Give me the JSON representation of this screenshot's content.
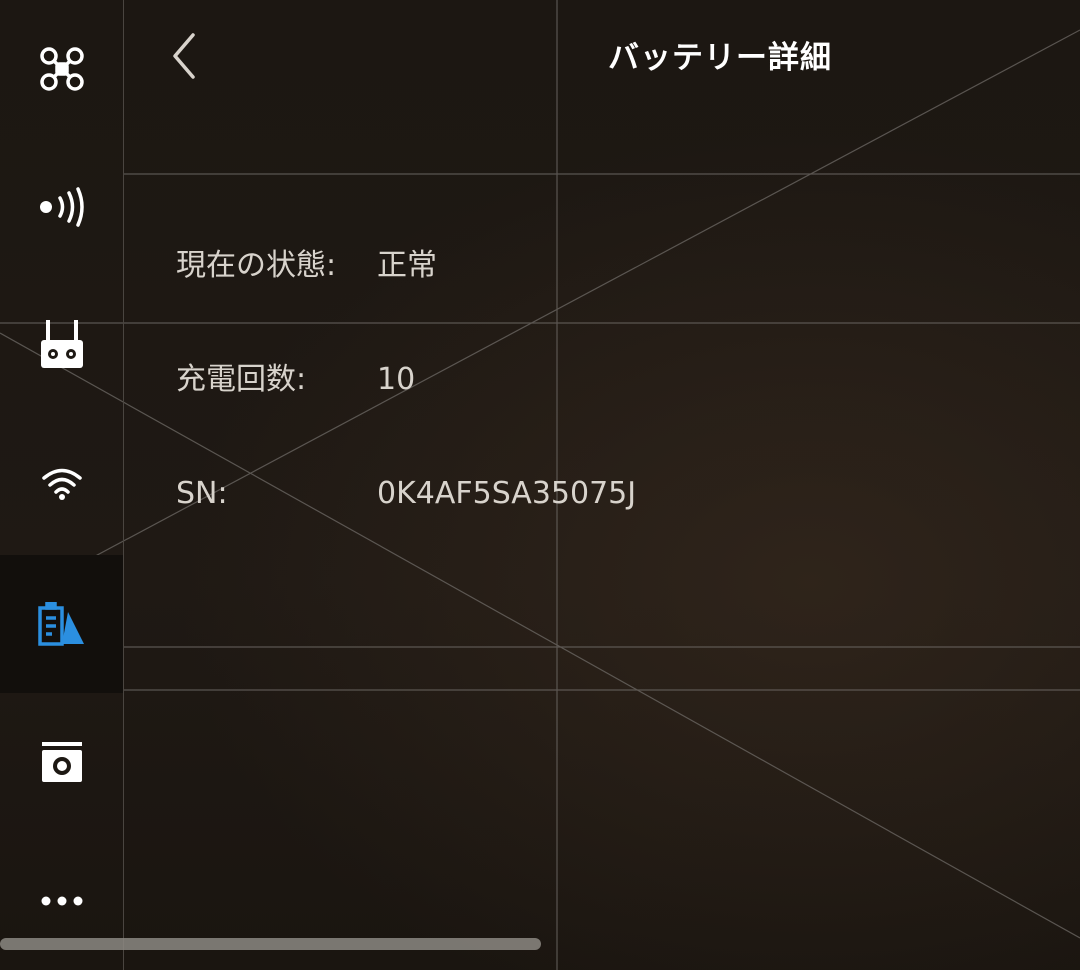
{
  "header": {
    "title": "バッテリー詳細",
    "back_icon": "chevron-left-icon"
  },
  "sidebar": {
    "items": [
      {
        "id": "aircraft",
        "icon": "drone-icon",
        "active": false
      },
      {
        "id": "sensors",
        "icon": "signal-broadcast-icon",
        "active": false
      },
      {
        "id": "remote-controller",
        "icon": "remote-controller-icon",
        "active": false
      },
      {
        "id": "transmission",
        "icon": "wifi-icon",
        "active": false
      },
      {
        "id": "battery",
        "icon": "battery-icon",
        "active": true
      },
      {
        "id": "camera",
        "icon": "camera-icon",
        "active": false
      },
      {
        "id": "more",
        "icon": "more-dots-icon",
        "active": false
      }
    ],
    "active_color": "#2b8fe0"
  },
  "details": {
    "status": {
      "label": "現在の状態:",
      "value": "正常"
    },
    "charge_count": {
      "label": "充電回数:",
      "value": "10"
    },
    "serial": {
      "label": "SN:",
      "value": "0K4AF5SA35075J"
    }
  },
  "colors": {
    "background": "#1d1813",
    "text": "#d8d3cc",
    "title": "#ffffff",
    "accent": "#2b8fe0"
  }
}
